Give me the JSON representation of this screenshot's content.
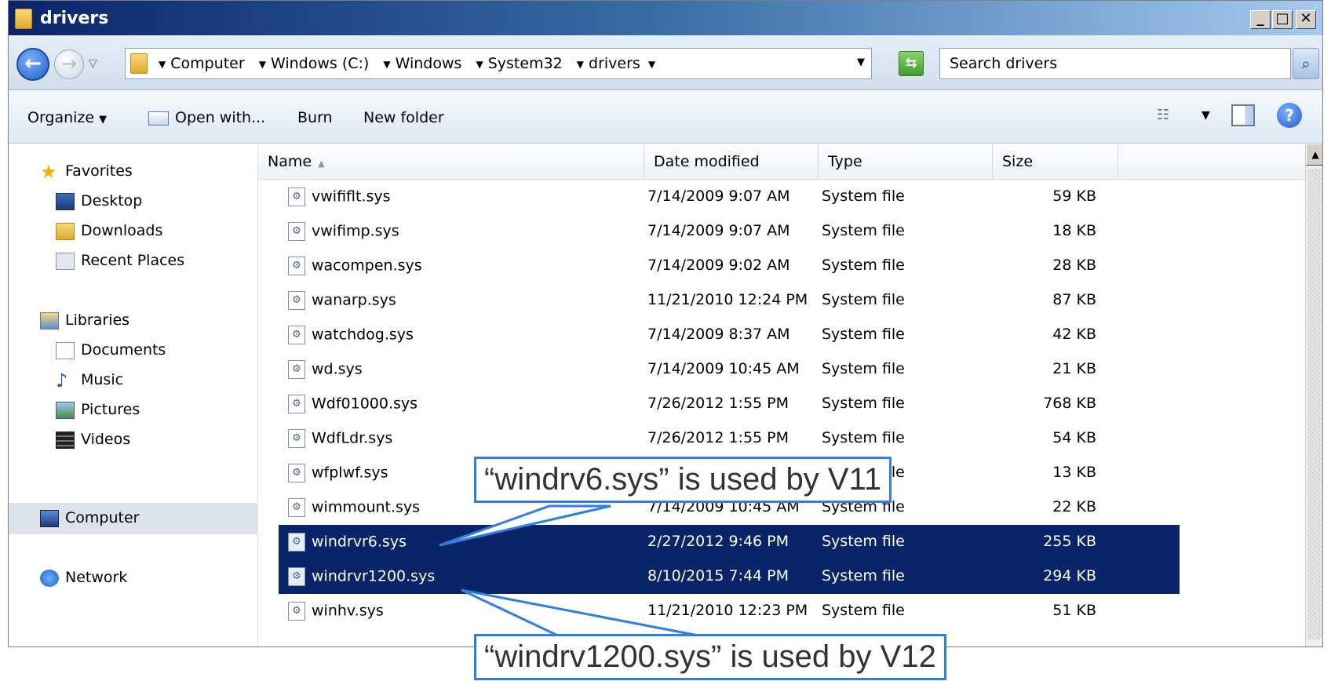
{
  "window": {
    "title": "drivers",
    "minimize": "_",
    "maximize": "□",
    "close": "✕"
  },
  "address": {
    "back_icon": "arrow-left-icon",
    "forward_icon": "arrow-right-icon",
    "breadcrumbs": [
      "Computer",
      "Windows (C:)",
      "Windows",
      "System32",
      "drivers"
    ],
    "search_placeholder": "Search drivers"
  },
  "toolbar": {
    "organize": "Organize",
    "open_with": "Open with...",
    "burn": "Burn",
    "new_folder": "New folder"
  },
  "nav": {
    "favorites": "Favorites",
    "desktop": "Desktop",
    "downloads": "Downloads",
    "recent_places": "Recent Places",
    "libraries": "Libraries",
    "documents": "Documents",
    "music": "Music",
    "pictures": "Pictures",
    "videos": "Videos",
    "computer": "Computer",
    "network": "Network"
  },
  "columns": {
    "name": "Name",
    "date": "Date modified",
    "type": "Type",
    "size": "Size"
  },
  "files": [
    {
      "name": "vwififlt.sys",
      "date": "7/14/2009 9:07 AM",
      "type": "System file",
      "size": "59 KB",
      "selected": false
    },
    {
      "name": "vwifimp.sys",
      "date": "7/14/2009 9:07 AM",
      "type": "System file",
      "size": "18 KB",
      "selected": false
    },
    {
      "name": "wacompen.sys",
      "date": "7/14/2009 9:02 AM",
      "type": "System file",
      "size": "28 KB",
      "selected": false
    },
    {
      "name": "wanarp.sys",
      "date": "11/21/2010 12:24 PM",
      "type": "System file",
      "size": "87 KB",
      "selected": false
    },
    {
      "name": "watchdog.sys",
      "date": "7/14/2009 8:37 AM",
      "type": "System file",
      "size": "42 KB",
      "selected": false
    },
    {
      "name": "wd.sys",
      "date": "7/14/2009 10:45 AM",
      "type": "System file",
      "size": "21 KB",
      "selected": false
    },
    {
      "name": "Wdf01000.sys",
      "date": "7/26/2012 1:55 PM",
      "type": "System file",
      "size": "768 KB",
      "selected": false
    },
    {
      "name": "WdfLdr.sys",
      "date": "7/26/2012 1:55 PM",
      "type": "System file",
      "size": "54 KB",
      "selected": false
    },
    {
      "name": "wfplwf.sys",
      "date": "",
      "type": "System file",
      "size": "13 KB",
      "selected": false
    },
    {
      "name": "wimmount.sys",
      "date": "7/14/2009 10:45 AM",
      "type": "System file",
      "size": "22 KB",
      "selected": false
    },
    {
      "name": "windrvr6.sys",
      "date": "2/27/2012 9:46 PM",
      "type": "System file",
      "size": "255 KB",
      "selected": true
    },
    {
      "name": "windrvr1200.sys",
      "date": "8/10/2015 7:44 PM",
      "type": "System file",
      "size": "294 KB",
      "selected": true
    },
    {
      "name": "winhv.sys",
      "date": "11/21/2010 12:23 PM",
      "type": "System file",
      "size": "51 KB",
      "selected": false
    }
  ],
  "callouts": {
    "v11": "“windrv6.sys” is used by V11",
    "v12": "“windrv1200.sys” is used by V12",
    "color": "#2f7ee0"
  }
}
